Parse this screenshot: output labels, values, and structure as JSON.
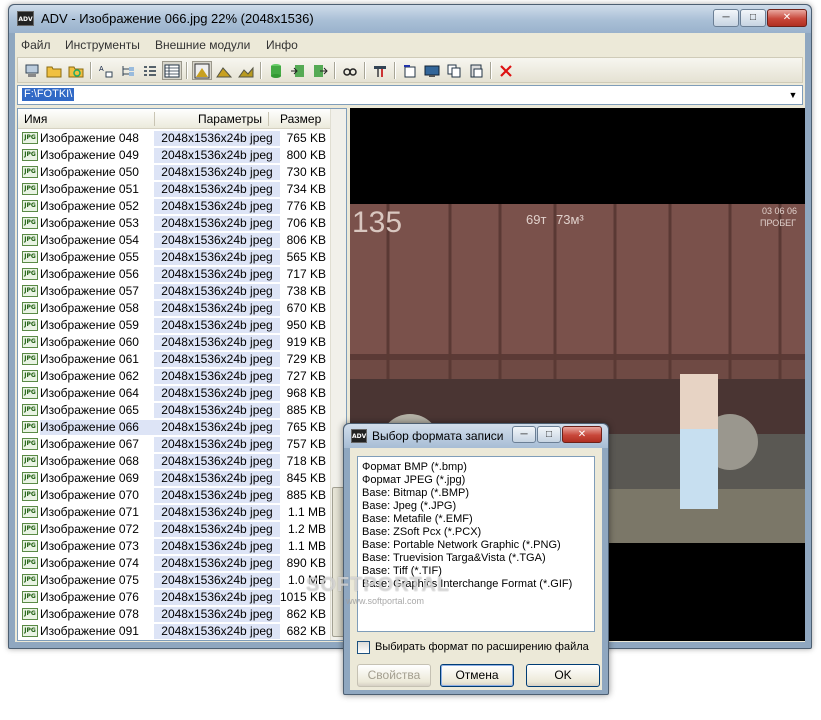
{
  "window": {
    "title": "ADV - Изображение 066.jpg   22%   (2048x1536)",
    "icon_label": "ADV",
    "controls": {
      "minimize": "─",
      "maximize": "□",
      "close": "✕"
    }
  },
  "menu": [
    "Файл",
    "Инструменты",
    "Внешние модули",
    "Инфо"
  ],
  "toolbar_icons": [
    "computer-icon",
    "open-folder-icon",
    "refresh-folder-icon",
    "sort-name-icon",
    "tree-view-icon",
    "list-view-icon",
    "details-view-icon",
    "auto-zoom-icon",
    "fit-image-icon",
    "image-icon",
    "database-icon",
    "import-icon",
    "export-icon",
    "glasses-icon",
    "tools-icon",
    "rotate-icon",
    "slideshow-icon",
    "copy-icon",
    "paste-icon",
    "delete-icon"
  ],
  "path": {
    "value": "F:\\FOTKI\\"
  },
  "filelist": {
    "columns": {
      "name": "Имя",
      "params": "Параметры",
      "size": "Размер"
    },
    "icon_label": "JPG",
    "rows": [
      {
        "name": "Изображение 048",
        "params": "2048x1536x24b jpeg",
        "size": "765 KB"
      },
      {
        "name": "Изображение 049",
        "params": "2048x1536x24b jpeg",
        "size": "800 KB"
      },
      {
        "name": "Изображение 050",
        "params": "2048x1536x24b jpeg",
        "size": "730 KB"
      },
      {
        "name": "Изображение 051",
        "params": "2048x1536x24b jpeg",
        "size": "734 KB"
      },
      {
        "name": "Изображение 052",
        "params": "2048x1536x24b jpeg",
        "size": "776 KB"
      },
      {
        "name": "Изображение 053",
        "params": "2048x1536x24b jpeg",
        "size": "706 KB"
      },
      {
        "name": "Изображение 054",
        "params": "2048x1536x24b jpeg",
        "size": "806 KB"
      },
      {
        "name": "Изображение 055",
        "params": "2048x1536x24b jpeg",
        "size": "565 KB"
      },
      {
        "name": "Изображение 056",
        "params": "2048x1536x24b jpeg",
        "size": "717 KB"
      },
      {
        "name": "Изображение 057",
        "params": "2048x1536x24b jpeg",
        "size": "738 KB"
      },
      {
        "name": "Изображение 058",
        "params": "2048x1536x24b jpeg",
        "size": "670 KB"
      },
      {
        "name": "Изображение 059",
        "params": "2048x1536x24b jpeg",
        "size": "950 KB"
      },
      {
        "name": "Изображение 060",
        "params": "2048x1536x24b jpeg",
        "size": "919 KB"
      },
      {
        "name": "Изображение 061",
        "params": "2048x1536x24b jpeg",
        "size": "729 KB"
      },
      {
        "name": "Изображение 062",
        "params": "2048x1536x24b jpeg",
        "size": "727 KB"
      },
      {
        "name": "Изображение 064",
        "params": "2048x1536x24b jpeg",
        "size": "968 KB"
      },
      {
        "name": "Изображение 065",
        "params": "2048x1536x24b jpeg",
        "size": "885 KB"
      },
      {
        "name": "Изображение 066",
        "params": "2048x1536x24b jpeg",
        "size": "765 KB"
      },
      {
        "name": "Изображение 067",
        "params": "2048x1536x24b jpeg",
        "size": "757 KB"
      },
      {
        "name": "Изображение 068",
        "params": "2048x1536x24b jpeg",
        "size": "718 KB"
      },
      {
        "name": "Изображение 069",
        "params": "2048x1536x24b jpeg",
        "size": "845 KB"
      },
      {
        "name": "Изображение 070",
        "params": "2048x1536x24b jpeg",
        "size": "885 KB"
      },
      {
        "name": "Изображение 071",
        "params": "2048x1536x24b jpeg",
        "size": "1.1 MB"
      },
      {
        "name": "Изображение 072",
        "params": "2048x1536x24b jpeg",
        "size": "1.2 MB"
      },
      {
        "name": "Изображение 073",
        "params": "2048x1536x24b jpeg",
        "size": "1.1 MB"
      },
      {
        "name": "Изображение 074",
        "params": "2048x1536x24b jpeg",
        "size": "890 KB"
      },
      {
        "name": "Изображение 075",
        "params": "2048x1536x24b jpeg",
        "size": "1.0 MB"
      },
      {
        "name": "Изображение 076",
        "params": "2048x1536x24b jpeg",
        "size": "1015 KB"
      },
      {
        "name": "Изображение 078",
        "params": "2048x1536x24b jpeg",
        "size": "862 KB"
      },
      {
        "name": "Изображение 091",
        "params": "2048x1536x24b jpeg",
        "size": "682 KB"
      }
    ]
  },
  "preview": {
    "photo_texts": [
      "135",
      "69т",
      "73м³",
      "03 06 06",
      "ПРОБЕГ"
    ]
  },
  "dialog": {
    "title": "Выбор формата записи",
    "icon_label": "ADV",
    "formats": [
      "Формат BMP  (*.bmp)",
      "Формат JPEG  (*.jpg)",
      "Base:  Bitmap  (*.BMP)",
      "Base:  Jpeg  (*.JPG)",
      "Base:  Metafile  (*.EMF)",
      "Base:  ZSoft Pcx  (*.PCX)",
      "Base:  Portable Network Graphic  (*.PNG)",
      "Base:  Truevision Targa&Vista  (*.TGA)",
      "Base:  Tiff  (*.TIF)",
      "Base:  Graphics Interchange Format  (*.GIF)"
    ],
    "checkbox_label": "Выбирать формат по расширению файла",
    "buttons": {
      "properties": "Свойства",
      "cancel": "Отмена",
      "ok": "OK"
    }
  },
  "watermark": {
    "brand": "SOFTPORTAL",
    "url": "www.softportal.com"
  }
}
